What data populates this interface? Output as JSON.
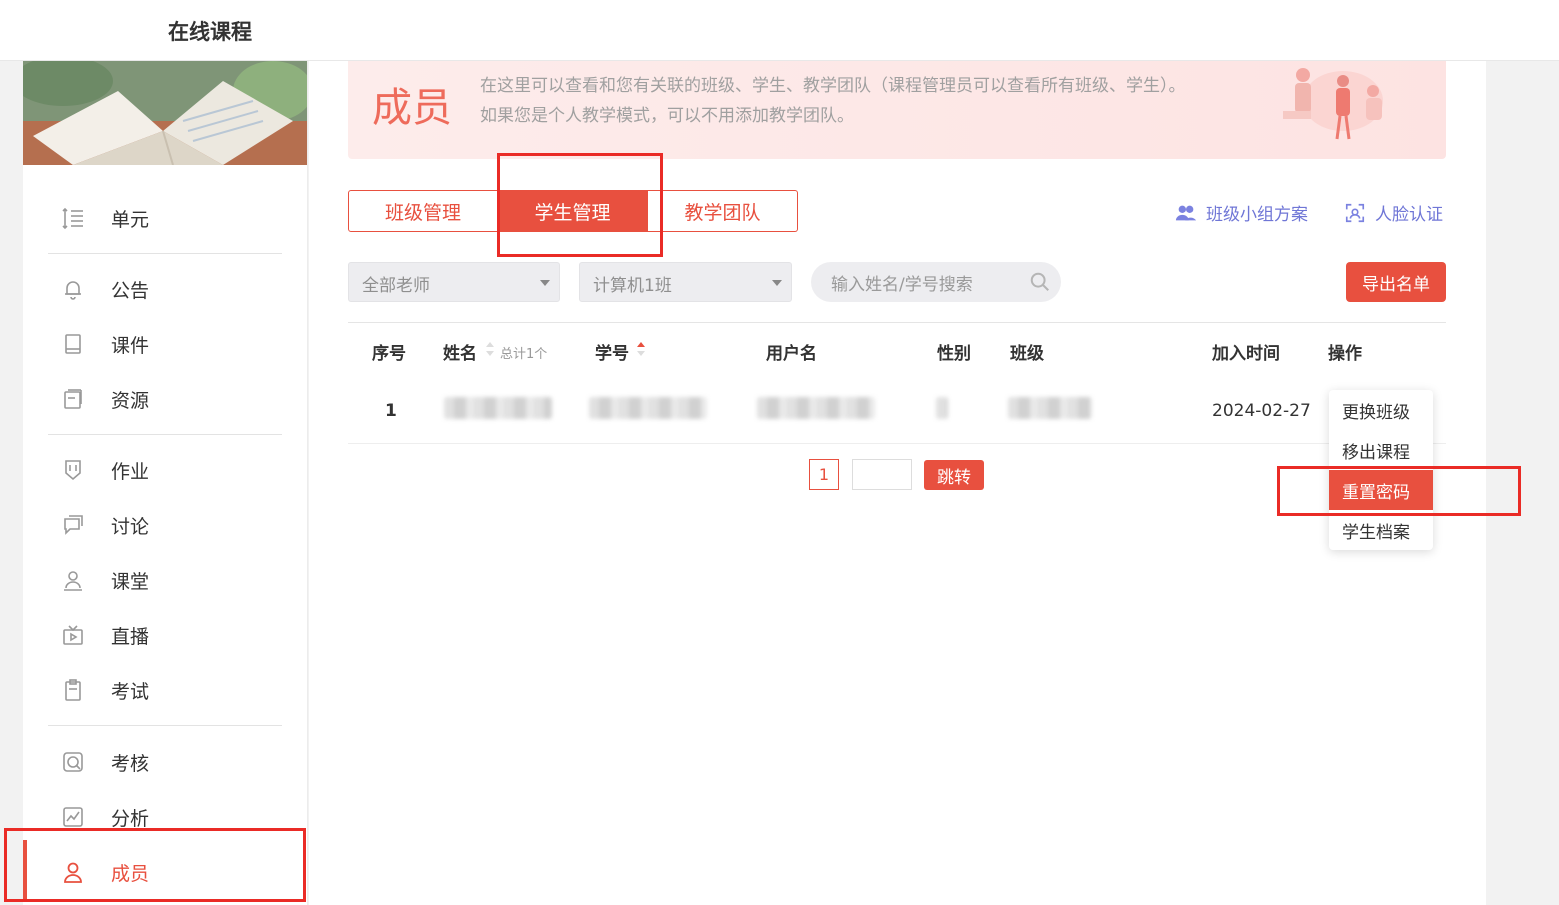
{
  "topbar": {
    "title": "在线课程"
  },
  "sidebar": {
    "items": [
      {
        "label": "单元",
        "icon": "list-icon"
      },
      {
        "label": "公告",
        "icon": "bell-icon"
      },
      {
        "label": "课件",
        "icon": "book-icon"
      },
      {
        "label": "资源",
        "icon": "folder-icon"
      },
      {
        "label": "作业",
        "icon": "homework-icon"
      },
      {
        "label": "讨论",
        "icon": "chat-icon"
      },
      {
        "label": "课堂",
        "icon": "classroom-icon"
      },
      {
        "label": "直播",
        "icon": "tv-icon"
      },
      {
        "label": "考试",
        "icon": "exam-icon"
      },
      {
        "label": "考核",
        "icon": "assess-icon"
      },
      {
        "label": "分析",
        "icon": "chart-icon"
      },
      {
        "label": "成员",
        "icon": "person-icon",
        "active": true
      }
    ]
  },
  "banner": {
    "title": "成员",
    "line1": "在这里可以查看和您有关联的班级、学生、教学团队（课程管理员可以查看所有班级、学生）。",
    "line2": "如果您是个人教学模式，可以不用添加教学团队。"
  },
  "tabs": [
    {
      "label": "班级管理",
      "active": false
    },
    {
      "label": "学生管理",
      "active": true
    },
    {
      "label": "教学团队",
      "active": false
    }
  ],
  "links": {
    "group_plan": "班级小组方案",
    "face_auth": "人脸认证"
  },
  "filters": {
    "teacher": "全部老师",
    "class": "计算机1班",
    "search_placeholder": "输入姓名/学号搜索",
    "export": "导出名单"
  },
  "table": {
    "headers": {
      "index": "序号",
      "name": "姓名",
      "total": "总计1个",
      "student_id": "学号",
      "username": "用户名",
      "gender": "性别",
      "class": "班级",
      "join_time": "加入时间",
      "action": "操作"
    },
    "rows": [
      {
        "index": "1",
        "join_time": "2024-02-27"
      }
    ]
  },
  "pagination": {
    "current": "1",
    "jump": "跳转"
  },
  "action_menu": {
    "items": [
      "更换班级",
      "移出课程",
      "重置密码",
      "学生档案"
    ],
    "highlighted": "重置密码"
  },
  "colors": {
    "accent": "#e8503f",
    "link": "#6f76d6",
    "annotation": "#ea2b26"
  }
}
